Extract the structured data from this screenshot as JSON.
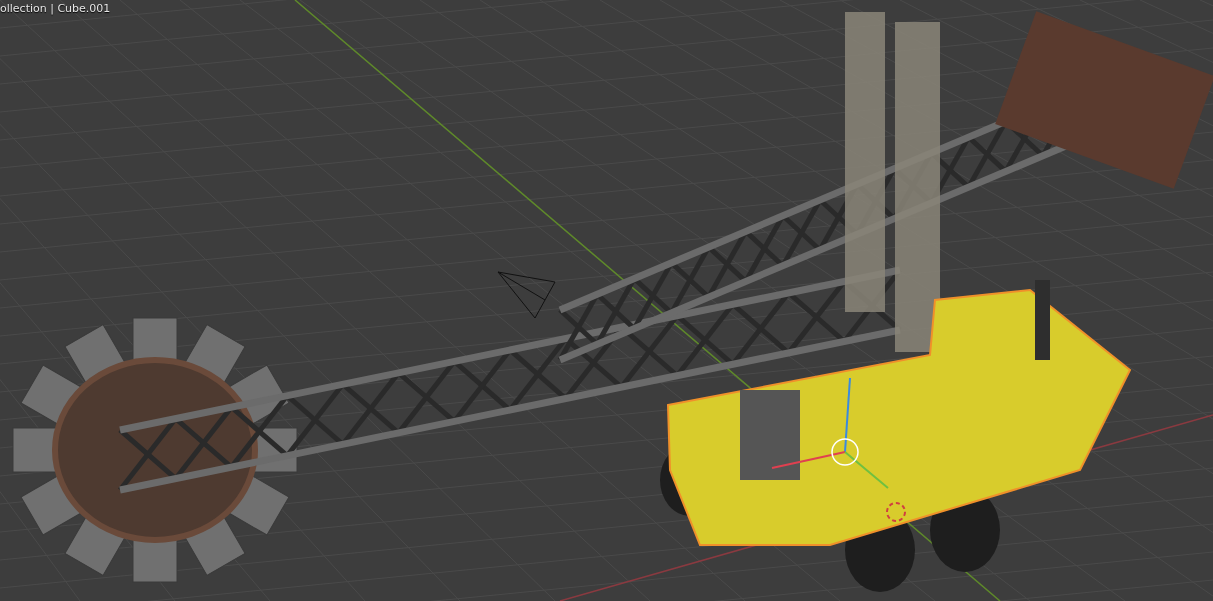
{
  "viewport": {
    "object_info": "ollection | Cube.001"
  }
}
